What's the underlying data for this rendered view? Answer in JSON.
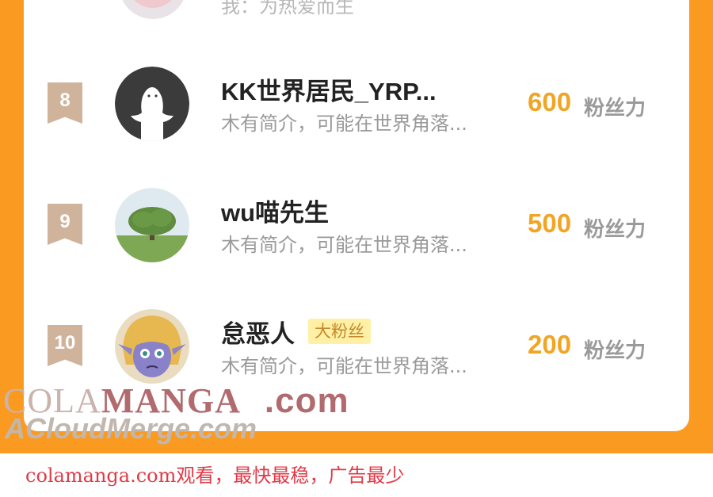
{
  "partial_entry": {
    "bio": "我：为热爱而生"
  },
  "entries": [
    {
      "rank": "8",
      "name": "KK世界居民_YRP...",
      "badge": "",
      "bio": "木有简介，可能在世界角落...",
      "score": "600",
      "unit": "粉丝力",
      "avatar": "ghost-avatar"
    },
    {
      "rank": "9",
      "name": "wu喵先生",
      "badge": "",
      "bio": "木有简介，可能在世界角落...",
      "score": "500",
      "unit": "粉丝力",
      "avatar": "tree-avatar"
    },
    {
      "rank": "10",
      "name": "怠恶人",
      "badge": "大粉丝",
      "bio": "木有简介，可能在世界角落...",
      "score": "200",
      "unit": "粉丝力",
      "avatar": "elf-avatar"
    }
  ],
  "watermark": {
    "line1_a": "COLA",
    "line1_b": "MANGA",
    "line1_c": ".com",
    "line2": "ACloudMerge.com"
  },
  "footer": {
    "text": "colamanga.com观看，最快最稳，广告最少"
  },
  "colors": {
    "frame": "#fb9a21",
    "score": "#f1a524",
    "rank": "#cfb49b",
    "footer": "#e03a46"
  }
}
